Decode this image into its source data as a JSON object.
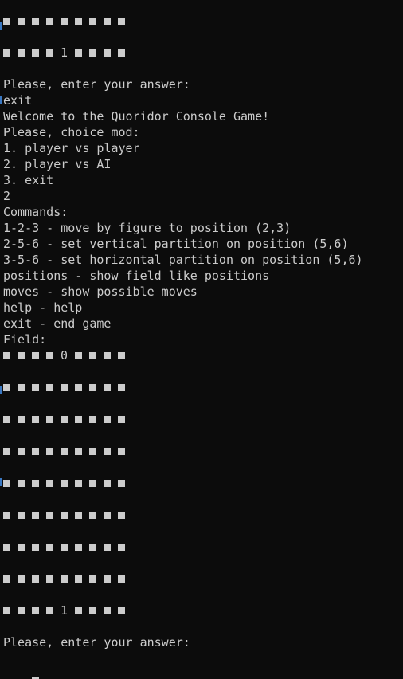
{
  "terminal": {
    "colors": {
      "background": "#0c0c0c",
      "foreground": "#cccccc",
      "edge_accent": "#3a78c2"
    },
    "board_before": [
      {
        "cells": [
          "sq",
          "sq",
          "sq",
          "sq",
          "sq",
          "sq",
          "sq",
          "sq",
          "sq"
        ]
      },
      {
        "cells": [
          "sq",
          "sq",
          "sq",
          "sq",
          "1",
          "sq",
          "sq",
          "sq",
          "sq"
        ]
      }
    ],
    "prompt_1": "Please, enter your answer:",
    "input_1": "exit",
    "welcome": "Welcome to the Quoridor Console Game!",
    "choose_mode": "Please, choice mod:",
    "mode_1": "1. player vs player",
    "mode_2": "2. player vs AI",
    "mode_3": "3. exit",
    "input_2": "2",
    "commands_header": "Commands:",
    "command_1": "1-2-3 - move by figure to position (2,3)",
    "command_2": "2-5-6 - set vertical partition on position (5,6)",
    "command_3": "3-5-6 - set horizontal partition on position (5,6)",
    "command_4": "positions - show field like positions",
    "command_5": "moves - show possible moves",
    "command_6": "help - help",
    "command_7": "exit - end game",
    "field_label": "Field:",
    "board_after": [
      {
        "cells": [
          "sq",
          "sq",
          "sq",
          "sq",
          "0",
          "sq",
          "sq",
          "sq",
          "sq"
        ]
      },
      {
        "cells": [
          "sq",
          "sq",
          "sq",
          "sq",
          "sq",
          "sq",
          "sq",
          "sq",
          "sq"
        ]
      },
      {
        "cells": [
          "sq",
          "sq",
          "sq",
          "sq",
          "sq",
          "sq",
          "sq",
          "sq",
          "sq"
        ]
      },
      {
        "cells": [
          "sq",
          "sq",
          "sq",
          "sq",
          "sq",
          "sq",
          "sq",
          "sq",
          "sq"
        ]
      },
      {
        "cells": [
          "sq",
          "sq",
          "sq",
          "sq",
          "sq",
          "sq",
          "sq",
          "sq",
          "sq"
        ]
      },
      {
        "cells": [
          "sq",
          "sq",
          "sq",
          "sq",
          "sq",
          "sq",
          "sq",
          "sq",
          "sq"
        ]
      },
      {
        "cells": [
          "sq",
          "sq",
          "sq",
          "sq",
          "sq",
          "sq",
          "sq",
          "sq",
          "sq"
        ]
      },
      {
        "cells": [
          "sq",
          "sq",
          "sq",
          "sq",
          "sq",
          "sq",
          "sq",
          "sq",
          "sq"
        ]
      },
      {
        "cells": [
          "sq",
          "sq",
          "sq",
          "sq",
          "1",
          "sq",
          "sq",
          "sq",
          "sq"
        ]
      }
    ],
    "prompt_2": "Please, enter your answer:"
  }
}
